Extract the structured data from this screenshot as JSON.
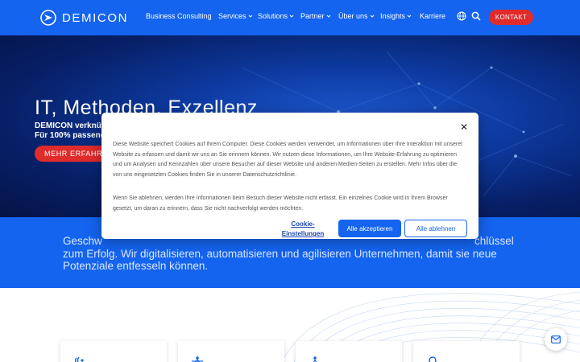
{
  "header": {
    "logo_text": "DEMICON",
    "nav": [
      {
        "label": "Business Consulting",
        "has_dropdown": false
      },
      {
        "label": "Services",
        "has_dropdown": true
      },
      {
        "label": "Solutions",
        "has_dropdown": true
      },
      {
        "label": "Partner",
        "has_dropdown": true
      },
      {
        "label": "Über uns",
        "has_dropdown": true
      },
      {
        "label": "Insights",
        "has_dropdown": true
      },
      {
        "label": "Karriere",
        "has_dropdown": false
      }
    ],
    "icons": [
      "globe-icon",
      "search-icon"
    ],
    "contact_label": "KONTAKT",
    "brand_color": "#1464f0",
    "accent_color": "#e02b2b"
  },
  "hero": {
    "title": "IT, Methoden, Exzellenz",
    "line1": "DEMICON verknü",
    "line2": "Für 100% passend",
    "cta_label": "MEHR ERFAHREN"
  },
  "intro": {
    "line1_left": "Geschw",
    "line1_right": "chlüssel",
    "line2": "zum Erfolg. Wir digitalisieren, automatisieren und agilisieren Unternehmen, damit sie neue",
    "line3": "Potenziale entfesseln können."
  },
  "cookie_dialog": {
    "paragraph1": "Diese Website speichert Cookies auf Ihrem Computer. Diese Cookies werden verwendet, um Informationen über Ihre Interaktion mit unserer Website zu erfassen und damit wir uns an Sie erinnern können. Wir nutzen diese Informationen, um Ihre Website-Erfahrung zu optimieren und um Analysen und Kennzahlen über unsere Besucher auf dieser Website und anderen Medien-Seiten zu erstellen. Mehr Infos über die von uns eingesetzten Cookies finden Sie in unserer Datenschutzrichtlinie.",
    "paragraph2": "Wenn Sie ablehnen, werden Ihre Informationen beim Besuch dieser Website nicht erfasst. Ein einzelnes Cookie wird in Ihrem Browser gesetzt, um daran zu erinnern, dass Sie nicht nachverfolgt werden möchten.",
    "settings_label": "Cookie-Einstellungen",
    "accept_label": "Alle akzeptieren",
    "decline_label": "Alle ablehnen",
    "close_icon": "close-icon"
  },
  "floating": {
    "icon": "mail-icon"
  }
}
